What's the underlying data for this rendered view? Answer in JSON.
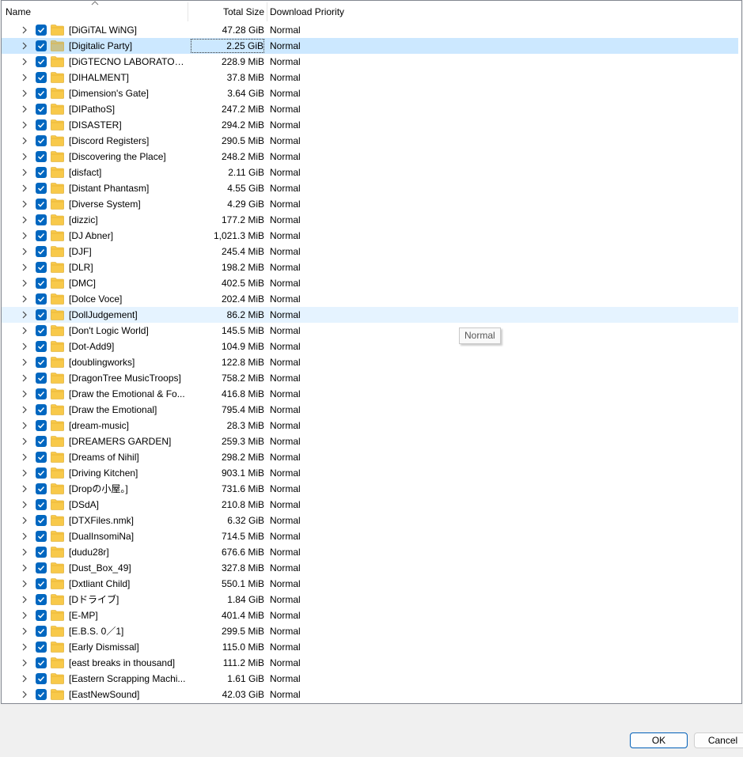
{
  "columns": {
    "name": "Name",
    "size": "Total Size",
    "priority": "Download Priority"
  },
  "rows": [
    {
      "name": "[DiGiTAL WiNG]",
      "size": "47.28 GiB",
      "priority": "Normal",
      "state": ""
    },
    {
      "name": "[Digitalic Party]",
      "size": "2.25 GiB",
      "priority": "Normal",
      "state": "selected"
    },
    {
      "name": "[DiGTECNO LABORATORY]",
      "size": "228.9 MiB",
      "priority": "Normal",
      "state": ""
    },
    {
      "name": "[DIHALMENT]",
      "size": "37.8 MiB",
      "priority": "Normal",
      "state": ""
    },
    {
      "name": "[Dimension's Gate]",
      "size": "3.64 GiB",
      "priority": "Normal",
      "state": ""
    },
    {
      "name": "[DIPathoS]",
      "size": "247.2 MiB",
      "priority": "Normal",
      "state": ""
    },
    {
      "name": "[DISASTER]",
      "size": "294.2 MiB",
      "priority": "Normal",
      "state": ""
    },
    {
      "name": "[Discord Registers]",
      "size": "290.5 MiB",
      "priority": "Normal",
      "state": ""
    },
    {
      "name": "[Discovering the Place]",
      "size": "248.2 MiB",
      "priority": "Normal",
      "state": ""
    },
    {
      "name": "[disfact]",
      "size": "2.11 GiB",
      "priority": "Normal",
      "state": ""
    },
    {
      "name": "[Distant Phantasm]",
      "size": "4.55 GiB",
      "priority": "Normal",
      "state": ""
    },
    {
      "name": "[Diverse System]",
      "size": "4.29 GiB",
      "priority": "Normal",
      "state": ""
    },
    {
      "name": "[dizzic]",
      "size": "177.2 MiB",
      "priority": "Normal",
      "state": ""
    },
    {
      "name": "[DJ Abner]",
      "size": "1,021.3 MiB",
      "priority": "Normal",
      "state": ""
    },
    {
      "name": "[DJF]",
      "size": "245.4 MiB",
      "priority": "Normal",
      "state": ""
    },
    {
      "name": "[DLR]",
      "size": "198.2 MiB",
      "priority": "Normal",
      "state": ""
    },
    {
      "name": "[DMC]",
      "size": "402.5 MiB",
      "priority": "Normal",
      "state": ""
    },
    {
      "name": "[Dolce Voce]",
      "size": "202.4 MiB",
      "priority": "Normal",
      "state": ""
    },
    {
      "name": "[DollJudgement]",
      "size": "86.2 MiB",
      "priority": "Normal",
      "state": "hover"
    },
    {
      "name": "[Don't Logic World]",
      "size": "145.5 MiB",
      "priority": "Normal",
      "state": ""
    },
    {
      "name": "[Dot-Add9]",
      "size": "104.9 MiB",
      "priority": "Normal",
      "state": ""
    },
    {
      "name": "[doublingworks]",
      "size": "122.8 MiB",
      "priority": "Normal",
      "state": ""
    },
    {
      "name": "[DragonTree MusicTroops]",
      "size": "758.2 MiB",
      "priority": "Normal",
      "state": ""
    },
    {
      "name": "[Draw the Emotional & Fo...",
      "size": "416.8 MiB",
      "priority": "Normal",
      "state": ""
    },
    {
      "name": "[Draw the Emotional]",
      "size": "795.4 MiB",
      "priority": "Normal",
      "state": ""
    },
    {
      "name": "[dream-music]",
      "size": "28.3 MiB",
      "priority": "Normal",
      "state": ""
    },
    {
      "name": "[DREAMERS GARDEN]",
      "size": "259.3 MiB",
      "priority": "Normal",
      "state": ""
    },
    {
      "name": "[Dreams of Nihil]",
      "size": "298.2 MiB",
      "priority": "Normal",
      "state": ""
    },
    {
      "name": "[Driving Kitchen]",
      "size": "903.1 MiB",
      "priority": "Normal",
      "state": ""
    },
    {
      "name": "[Dropの小屋。]",
      "size": "731.6 MiB",
      "priority": "Normal",
      "state": ""
    },
    {
      "name": "[DSdA]",
      "size": "210.8 MiB",
      "priority": "Normal",
      "state": ""
    },
    {
      "name": "[DTXFiles.nmk]",
      "size": "6.32 GiB",
      "priority": "Normal",
      "state": ""
    },
    {
      "name": "[DualInsomiNa]",
      "size": "714.5 MiB",
      "priority": "Normal",
      "state": ""
    },
    {
      "name": "[dudu28r]",
      "size": "676.6 MiB",
      "priority": "Normal",
      "state": ""
    },
    {
      "name": "[Dust_Box_49]",
      "size": "327.8 MiB",
      "priority": "Normal",
      "state": ""
    },
    {
      "name": "[Dxtliant Child]",
      "size": "550.1 MiB",
      "priority": "Normal",
      "state": ""
    },
    {
      "name": "[Dドライブ]",
      "size": "1.84 GiB",
      "priority": "Normal",
      "state": ""
    },
    {
      "name": "[E-MP]",
      "size": "401.4 MiB",
      "priority": "Normal",
      "state": ""
    },
    {
      "name": "[E.B.S. 0／1]",
      "size": "299.5 MiB",
      "priority": "Normal",
      "state": ""
    },
    {
      "name": "[Early Dismissal]",
      "size": "115.0 MiB",
      "priority": "Normal",
      "state": ""
    },
    {
      "name": "[east breaks in thousand]",
      "size": "111.2 MiB",
      "priority": "Normal",
      "state": ""
    },
    {
      "name": "[Eastern Scrapping Machi...",
      "size": "1.61 GiB",
      "priority": "Normal",
      "state": ""
    },
    {
      "name": "[EastNewSound]",
      "size": "42.03 GiB",
      "priority": "Normal",
      "state": ""
    }
  ],
  "tooltip": "Normal",
  "buttons": {
    "ok": "OK",
    "cancel": "Cancel"
  },
  "colors": {
    "accent": "#0067c0",
    "selected_row": "#cce8ff",
    "hover_row": "#e5f3ff",
    "folder": "#f8c94a"
  },
  "icons": {
    "expander": "chevron-right-icon",
    "checkbox": "checkmark-icon",
    "folder": "folder-icon",
    "sort": "sort-ascending-icon"
  }
}
